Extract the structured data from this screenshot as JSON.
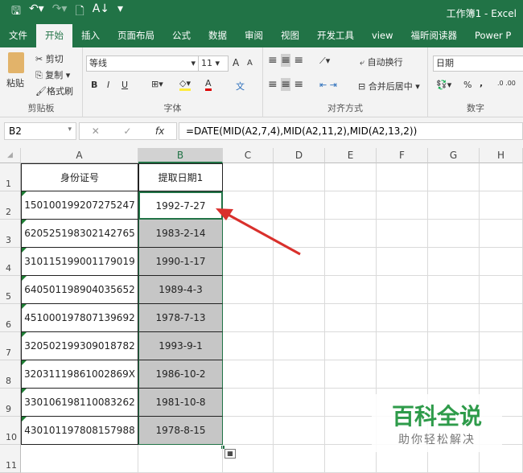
{
  "titlebar": {
    "title": "工作簿1  -  Excel",
    "icons": [
      "save-icon",
      "undo-icon",
      "redo-icon",
      "print-preview-icon",
      "sort-icon",
      "customize-icon"
    ]
  },
  "tabs": [
    "文件",
    "开始",
    "插入",
    "页面布局",
    "公式",
    "数据",
    "审阅",
    "视图",
    "开发工具",
    "view",
    "福昕阅读器",
    "Power P"
  ],
  "ribbon": {
    "clipboard": {
      "paste": "粘贴",
      "cut": "剪切",
      "copy": "复制",
      "format_painter": "格式刷",
      "label": "剪贴板"
    },
    "font": {
      "name": "等线",
      "size": "11",
      "bold": "B",
      "italic": "I",
      "underline": "U",
      "label": "字体",
      "grow": "A",
      "shrink": "A",
      "font_color": "A",
      "phonetic": "文"
    },
    "alignment": {
      "wrap": "自动换行",
      "merge": "合并后居中",
      "label": "对齐方式"
    },
    "number": {
      "format": "日期",
      "percent": "%",
      "comma": ",",
      "label": "数字"
    }
  },
  "formula_bar": {
    "name_box": "B2",
    "fx": "fx",
    "cancel": "✕",
    "enter": "✓",
    "formula": "=DATE(MID(A2,7,4),MID(A2,11,2),MID(A2,13,2))"
  },
  "columns": [
    "A",
    "B",
    "C",
    "D",
    "E",
    "F",
    "G",
    "H"
  ],
  "rows": [
    "1",
    "2",
    "3",
    "4",
    "5",
    "6",
    "7",
    "8",
    "9",
    "10",
    "11"
  ],
  "headers": {
    "a": "身份证号",
    "b": "提取日期1"
  },
  "data": [
    {
      "id": "150100199207275247",
      "date": "1992-7-27"
    },
    {
      "id": "620525198302142765",
      "date": "1983-2-14"
    },
    {
      "id": "310115199001179019",
      "date": "1990-1-17"
    },
    {
      "id": "640501198904035652",
      "date": "1989-4-3"
    },
    {
      "id": "451000197807139692",
      "date": "1978-7-13"
    },
    {
      "id": "320502199309018782",
      "date": "1993-9-1"
    },
    {
      "id": "32031119861002869X",
      "date": "1986-10-2"
    },
    {
      "id": "330106198110083262",
      "date": "1981-10-8"
    },
    {
      "id": "430101197808157988",
      "date": "1978-8-15"
    }
  ],
  "watermark": {
    "title": "百科全说",
    "subtitle": "助你轻松解决"
  },
  "colors": {
    "excel_green": "#217346",
    "arrow": "#d9302c"
  }
}
